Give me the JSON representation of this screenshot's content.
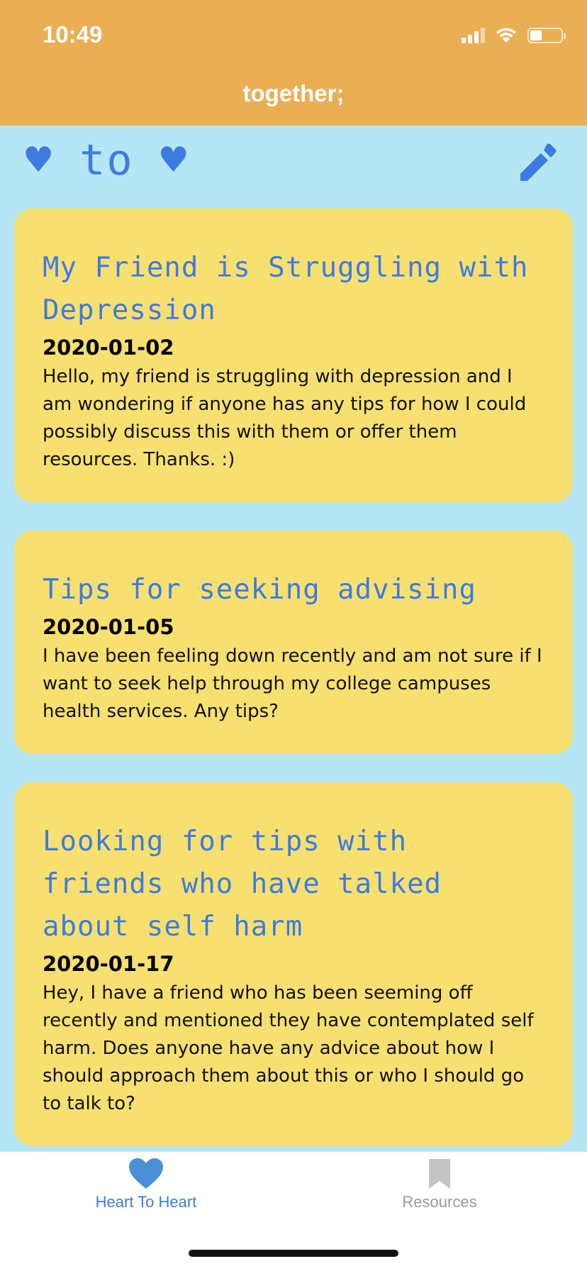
{
  "status_bar": {
    "time": "10:49"
  },
  "nav": {
    "title": "together;"
  },
  "header": {
    "logo_text": "♥ to ♥"
  },
  "colors": {
    "nav_background": "#eaae55",
    "page_background": "#b5e6f6",
    "card_background": "#f7e070",
    "accent_blue": "#3e7be0",
    "tab_inactive": "#b5b5b5"
  },
  "posts": [
    {
      "title": "My Friend is Struggling with Depression",
      "date": "2020-01-02",
      "body": "Hello, my friend is struggling with depression and I am wondering if anyone has any tips for how I could possibly discuss this with them or offer them resources. Thanks. :)"
    },
    {
      "title": "Tips for seeking advising",
      "date": "2020-01-05",
      "body": "I have been feeling down recently and am not sure if I want to seek help through my college campuses health services. Any tips?"
    },
    {
      "title": "Looking for tips with friends who have talked about self harm",
      "date": "2020-01-17",
      "body": "Hey, I have a friend who has been seeming off recently and mentioned they have contemplated self harm. Does anyone have any advice about how I should approach them about this or who I should go to talk to?"
    }
  ],
  "tabs": [
    {
      "label": "Heart To Heart",
      "icon": "heart-icon",
      "active": true
    },
    {
      "label": "Resources",
      "icon": "bookmark-icon",
      "active": false
    }
  ]
}
